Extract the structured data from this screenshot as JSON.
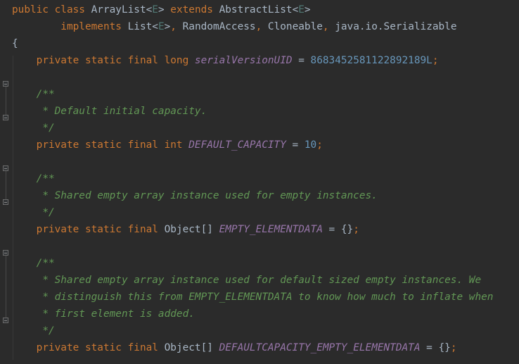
{
  "code": {
    "language": "Java",
    "lines": [
      [
        {
          "t": "public class ",
          "c": "kw"
        },
        {
          "t": "ArrayList",
          "c": "id"
        },
        {
          "t": "<",
          "c": "id"
        },
        {
          "t": "E",
          "c": "tp"
        },
        {
          "t": "> ",
          "c": "id"
        },
        {
          "t": "extends ",
          "c": "kw"
        },
        {
          "t": "AbstractList",
          "c": "id"
        },
        {
          "t": "<",
          "c": "id"
        },
        {
          "t": "E",
          "c": "tp"
        },
        {
          "t": ">",
          "c": "id"
        }
      ],
      [
        {
          "t": "        implements ",
          "c": "kw"
        },
        {
          "t": "List",
          "c": "id"
        },
        {
          "t": "<",
          "c": "id"
        },
        {
          "t": "E",
          "c": "tp"
        },
        {
          "t": ">",
          "c": "id"
        },
        {
          "t": ", ",
          "c": "pn"
        },
        {
          "t": "RandomAccess",
          "c": "id"
        },
        {
          "t": ", ",
          "c": "pn"
        },
        {
          "t": "Cloneable",
          "c": "id"
        },
        {
          "t": ", ",
          "c": "pn"
        },
        {
          "t": "java.io.Serializable",
          "c": "id"
        }
      ],
      [
        {
          "t": "{",
          "c": "id"
        }
      ],
      [
        {
          "t": "    private static final long ",
          "c": "kw"
        },
        {
          "t": "serialVersionUID",
          "c": "fld"
        },
        {
          "t": " = ",
          "c": "id"
        },
        {
          "t": "8683452581122892189L",
          "c": "num"
        },
        {
          "t": ";",
          "c": "pn"
        }
      ],
      [],
      [
        {
          "t": "    /**",
          "c": "cm"
        }
      ],
      [
        {
          "t": "     * Default initial capacity.",
          "c": "cm"
        }
      ],
      [
        {
          "t": "     */",
          "c": "cm"
        }
      ],
      [
        {
          "t": "    private static final int ",
          "c": "kw"
        },
        {
          "t": "DEFAULT_CAPACITY",
          "c": "fld"
        },
        {
          "t": " = ",
          "c": "id"
        },
        {
          "t": "10",
          "c": "num"
        },
        {
          "t": ";",
          "c": "pn"
        }
      ],
      [],
      [
        {
          "t": "    /**",
          "c": "cm"
        }
      ],
      [
        {
          "t": "     * Shared empty array instance used for empty instances.",
          "c": "cm"
        }
      ],
      [
        {
          "t": "     */",
          "c": "cm"
        }
      ],
      [
        {
          "t": "    private static final ",
          "c": "kw"
        },
        {
          "t": "Object[] ",
          "c": "id"
        },
        {
          "t": "EMPTY_ELEMENTDATA",
          "c": "fld"
        },
        {
          "t": " = {}",
          "c": "id"
        },
        {
          "t": ";",
          "c": "pn"
        }
      ],
      [],
      [
        {
          "t": "    /**",
          "c": "cm"
        }
      ],
      [
        {
          "t": "     * Shared empty array instance used for default sized empty instances. We",
          "c": "cm"
        }
      ],
      [
        {
          "t": "     * distinguish this from EMPTY_ELEMENTDATA to know how much to inflate when",
          "c": "cm"
        }
      ],
      [
        {
          "t": "     * first element is added.",
          "c": "cm"
        }
      ],
      [
        {
          "t": "     */",
          "c": "cm"
        }
      ],
      [
        {
          "t": "    private static final ",
          "c": "kw"
        },
        {
          "t": "Object[] ",
          "c": "id"
        },
        {
          "t": "DEFAULTCAPACITY_EMPTY_ELEMENTDATA",
          "c": "fld"
        },
        {
          "t": " = {}",
          "c": "id"
        },
        {
          "t": ";",
          "c": "pn"
        }
      ]
    ]
  },
  "colors": {
    "background": "#2b2b2b",
    "keyword": "#cc7832",
    "identifier": "#a9b7c6",
    "type_param": "#507874",
    "field": "#9876aa",
    "number": "#6897bb",
    "comment": "#629755"
  },
  "gutter": {
    "fold_markers": [
      {
        "line": 5,
        "kind": "open"
      },
      {
        "line": 7,
        "kind": "close"
      },
      {
        "line": 10,
        "kind": "open"
      },
      {
        "line": 12,
        "kind": "close"
      },
      {
        "line": 15,
        "kind": "open"
      },
      {
        "line": 19,
        "kind": "close"
      }
    ],
    "icons": [
      "fold-open-icon",
      "fold-close-icon"
    ]
  }
}
